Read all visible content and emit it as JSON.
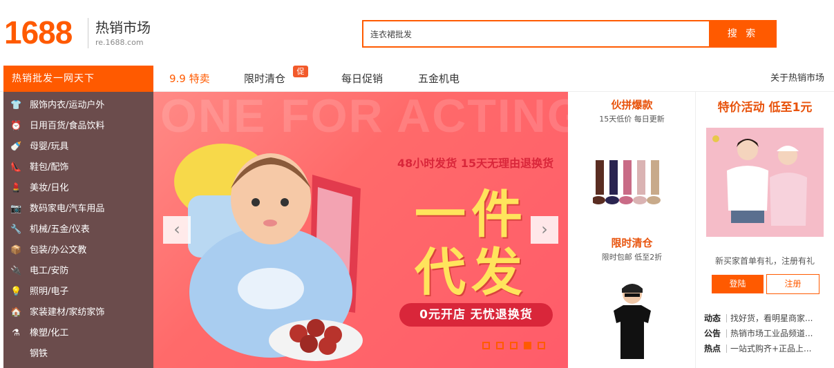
{
  "header": {
    "logo_number": "1688",
    "logo_title": "热销市场",
    "logo_domain": "re.1688.com",
    "search": {
      "value": "连衣裙批发",
      "button_label": "搜 索"
    }
  },
  "nav": {
    "category_header": "热销批发一网天下",
    "items": [
      {
        "label": "9.9 特卖",
        "active": true
      },
      {
        "label": "限时清仓",
        "badge": "促"
      },
      {
        "label": "每日促销"
      },
      {
        "label": "五金机电"
      }
    ],
    "about": "关于热销市场"
  },
  "categories": [
    {
      "icon": "shirt-icon",
      "glyph": "👕",
      "label": "服饰内衣/运动户外"
    },
    {
      "icon": "alarm-clock-icon",
      "glyph": "⏰",
      "label": "日用百货/食品饮料"
    },
    {
      "icon": "bottle-icon",
      "glyph": "🍼",
      "label": "母婴/玩具"
    },
    {
      "icon": "high-heel-icon",
      "glyph": "👠",
      "label": "鞋包/配饰"
    },
    {
      "icon": "lipstick-icon",
      "glyph": "💄",
      "label": "美妆/日化"
    },
    {
      "icon": "camera-icon",
      "glyph": "📷",
      "label": "数码家电/汽车用品"
    },
    {
      "icon": "wrench-icon",
      "glyph": "🔧",
      "label": "机械/五金/仪表"
    },
    {
      "icon": "package-icon",
      "glyph": "📦",
      "label": "包装/办公文教"
    },
    {
      "icon": "plug-icon",
      "glyph": "🔌",
      "label": "电工/安防"
    },
    {
      "icon": "bulb-icon",
      "glyph": "💡",
      "label": "照明/电子"
    },
    {
      "icon": "home-icon",
      "glyph": "🏠",
      "label": "家装建材/家纺家饰"
    },
    {
      "icon": "flask-icon",
      "glyph": "⚗",
      "label": "橡塑/化工"
    },
    {
      "icon": "",
      "glyph": "",
      "label": "钢铁"
    }
  ],
  "banner": {
    "watermark": "ONE FOR ACTING",
    "subtitle": "48小时发货 15天无理由退换货",
    "headline_1": "一件",
    "headline_2": "代发",
    "pill": "0元开店 无忧退换货",
    "prev": "‹",
    "next": "›",
    "slide_count": 5,
    "active_slide": 4
  },
  "promo_middle": [
    {
      "title": "伙拼爆款",
      "subtitle": "15天低价 每日更新"
    },
    {
      "title": "限时清仓",
      "subtitle": "限时包邮 低至2折"
    }
  ],
  "promo_right": {
    "title": "特价活动 低至1元",
    "note": "新买家首单有礼，注册有礼",
    "login": "登陆",
    "register": "注册",
    "news": [
      {
        "tag": "动态",
        "text": "找好货，看明星商家..."
      },
      {
        "tag": "公告",
        "text": "热销市场工业品频道..."
      },
      {
        "tag": "热点",
        "text": "一站式购齐+正品上..."
      }
    ]
  },
  "colors": {
    "accent": "#ff5a00",
    "category_bg": "#6b4c4c",
    "banner_bg": "#ff6a6a",
    "headline": "#ffe45c"
  }
}
